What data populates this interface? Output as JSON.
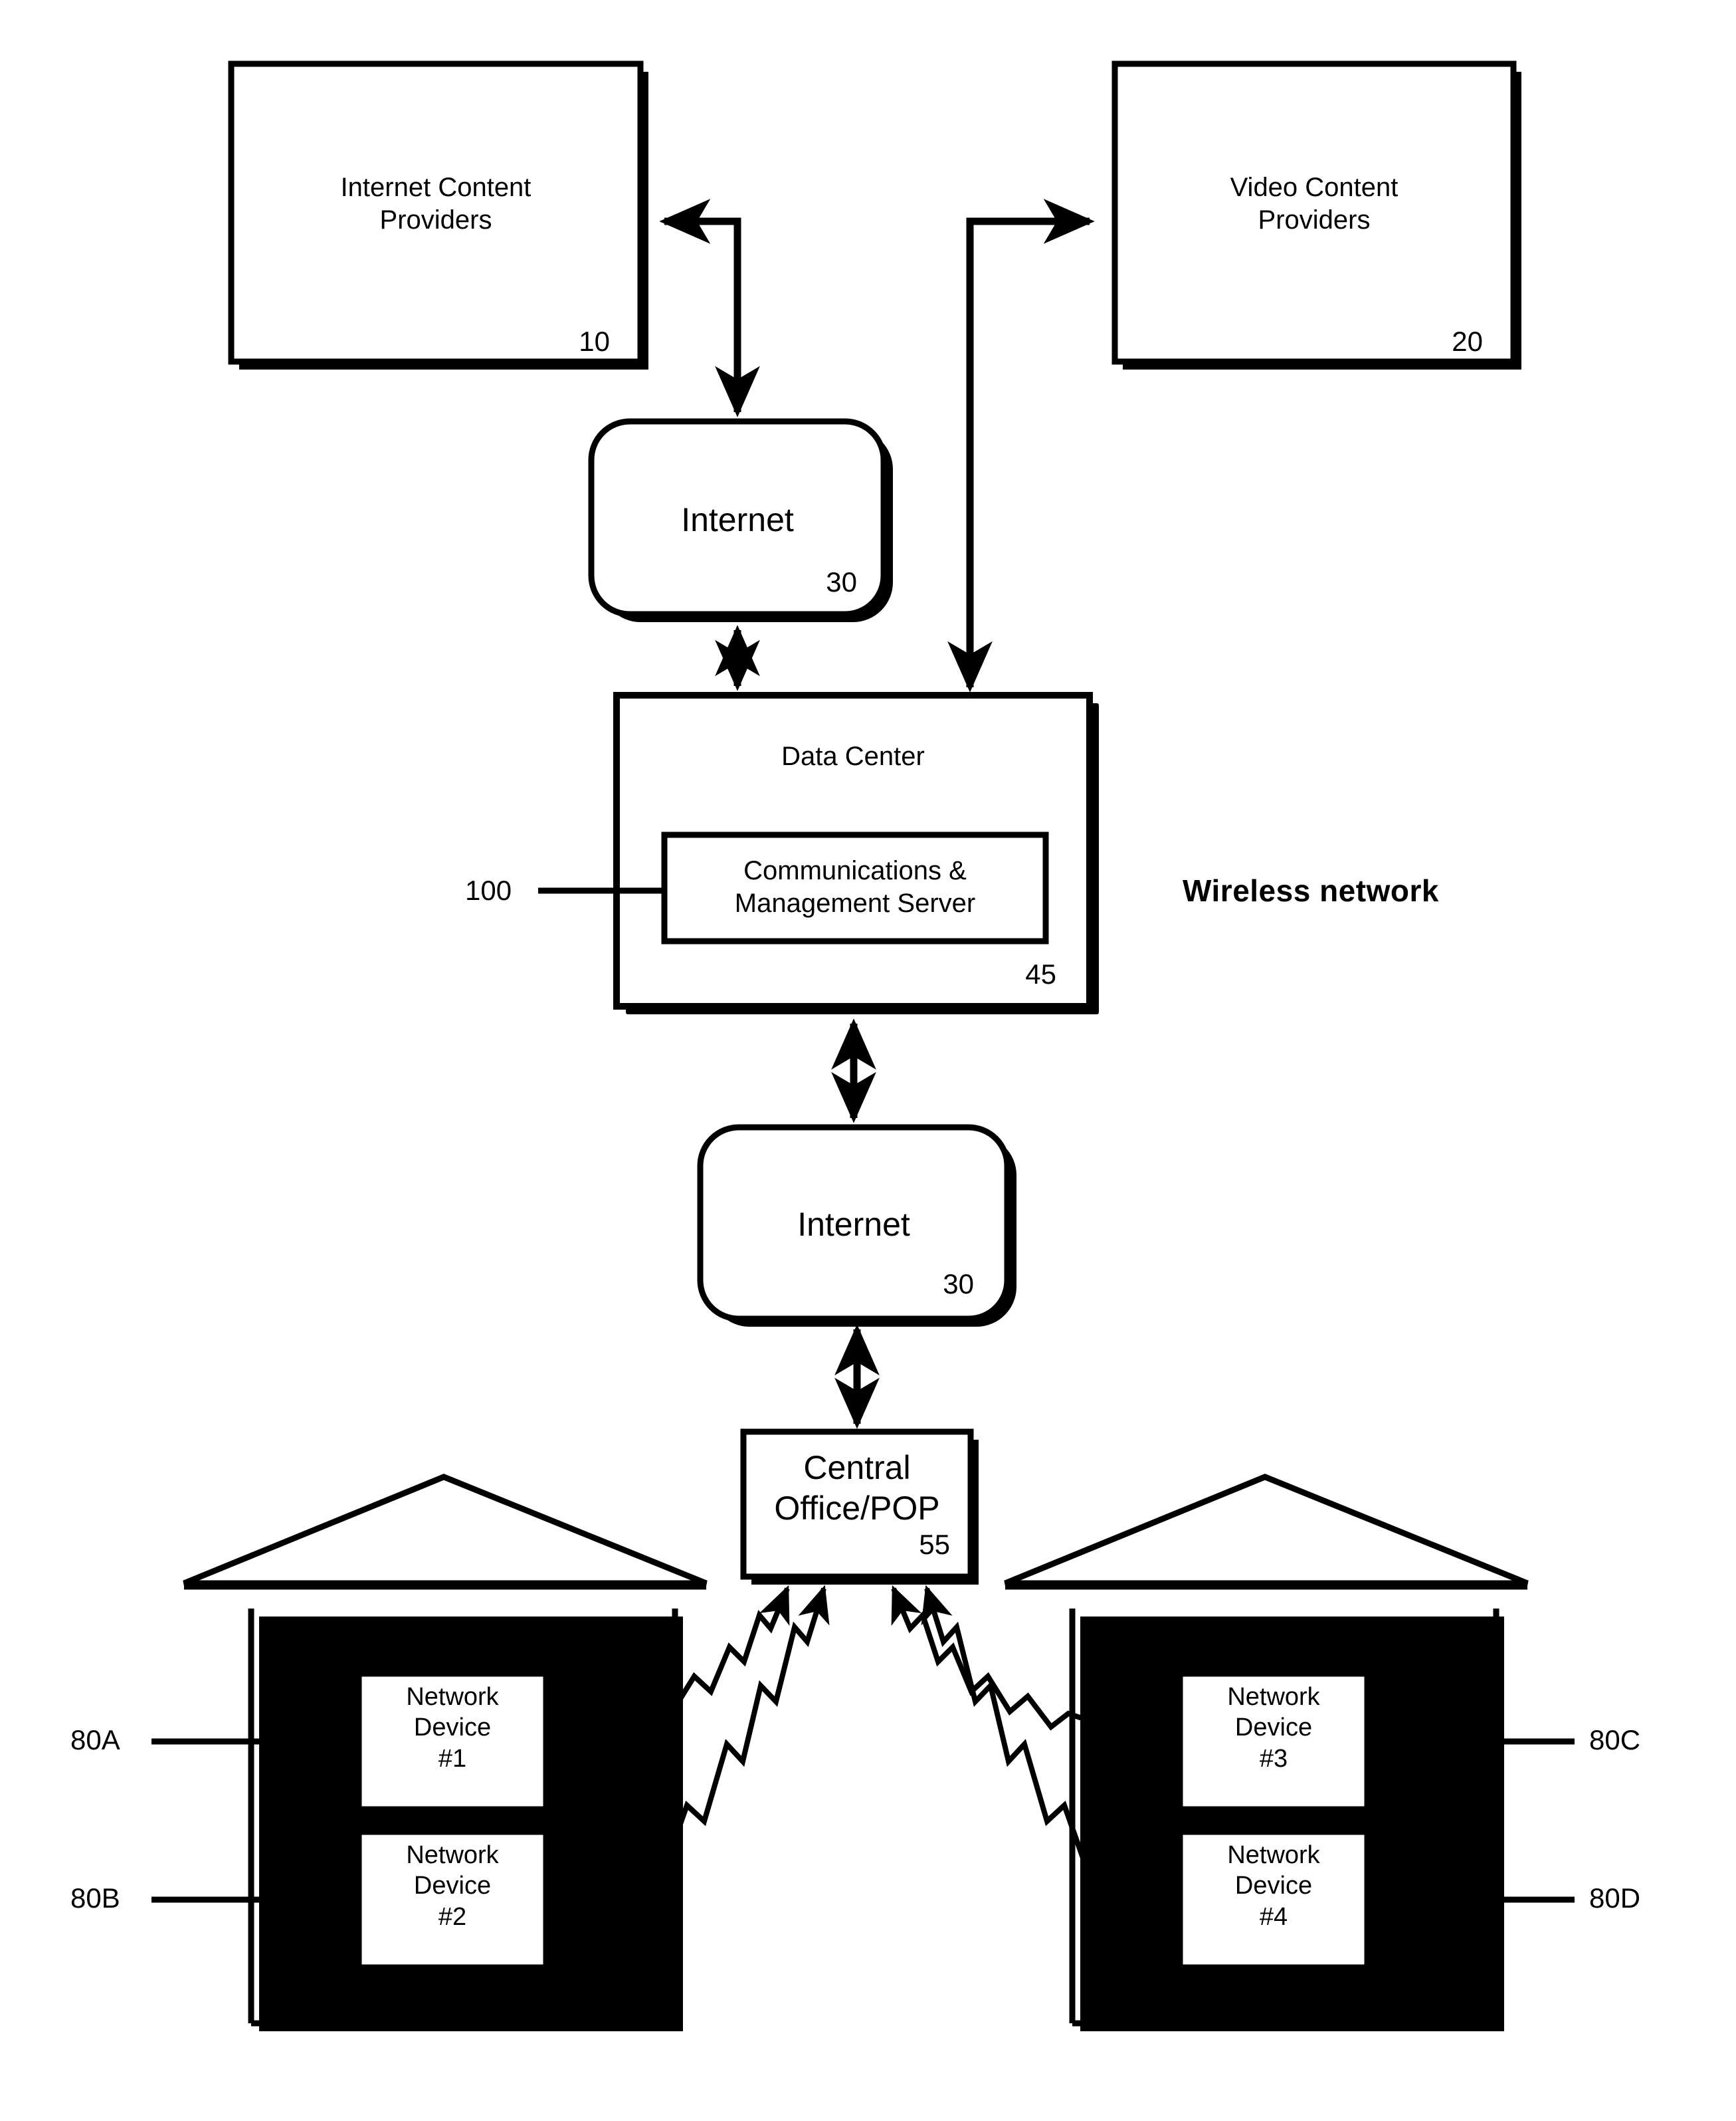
{
  "figure": {
    "type": "patent-network-diagram",
    "annotation": "Wireless network"
  },
  "nodes": {
    "internet_content_providers": {
      "label": "Internet Content\nProviders",
      "ref": "10"
    },
    "video_content_providers": {
      "label": "Video Content\nProviders",
      "ref": "20"
    },
    "internet_upper": {
      "label": "Internet",
      "ref": "30"
    },
    "internet_lower": {
      "label": "Internet",
      "ref": "30"
    },
    "data_center": {
      "label": "Data Center",
      "ref": "45"
    },
    "comm_mgmt_server": {
      "label": "Communications &\nManagement Server",
      "ref": "100"
    },
    "central_office": {
      "label": "Central\nOffice/POP",
      "ref": "55"
    },
    "network_device_1": {
      "label": "Network\nDevice\n#1",
      "ref": "80A"
    },
    "network_device_2": {
      "label": "Network\nDevice\n#2",
      "ref": "80B"
    },
    "network_device_3": {
      "label": "Network\nDevice\n#3",
      "ref": "80C"
    },
    "network_device_4": {
      "label": "Network\nDevice\n#4",
      "ref": "80D"
    },
    "house_left": {
      "label": "house-left"
    },
    "house_right": {
      "label": "house-right"
    }
  },
  "connections": [
    {
      "from": "internet_upper",
      "to": "internet_content_providers",
      "style": "elbow-arrow",
      "direction": "bidirectional-pair"
    },
    {
      "from": "data_center",
      "to": "video_content_providers",
      "style": "elbow-arrow",
      "direction": "bidirectional-pair"
    },
    {
      "from": "internet_upper",
      "to": "data_center",
      "style": "straight",
      "direction": "double"
    },
    {
      "from": "data_center",
      "to": "internet_lower",
      "style": "straight",
      "direction": "double"
    },
    {
      "from": "internet_lower",
      "to": "central_office",
      "style": "straight",
      "direction": "double"
    },
    {
      "from": "central_office",
      "to": "network_device_1",
      "style": "lightning",
      "direction": "double"
    },
    {
      "from": "central_office",
      "to": "network_device_2",
      "style": "lightning",
      "direction": "double"
    },
    {
      "from": "central_office",
      "to": "network_device_3",
      "style": "lightning",
      "direction": "double"
    },
    {
      "from": "central_office",
      "to": "network_device_4",
      "style": "lightning",
      "direction": "double"
    }
  ],
  "colors": {
    "ink": "#000000",
    "paper": "#ffffff"
  }
}
